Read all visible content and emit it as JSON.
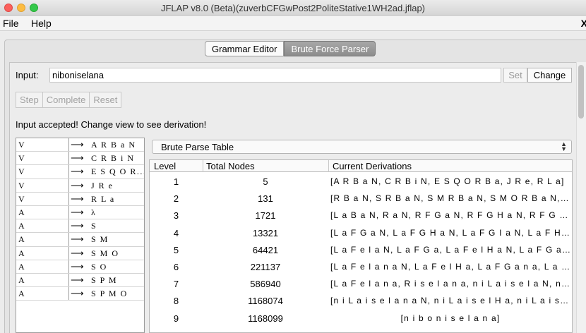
{
  "window": {
    "title": "JFLAP v8.0 (Beta)(zuverbCFGwPost2PoliteStative1WH2ad.jflap)"
  },
  "menu": {
    "file": "File",
    "help": "Help",
    "close": "X"
  },
  "tabs": {
    "grammar_editor": "Grammar Editor",
    "brute_force_parser": "Brute Force Parser"
  },
  "input": {
    "label": "Input:",
    "value": "niboniselana",
    "set_label": "Set",
    "change_label": "Change"
  },
  "controls": {
    "step": "Step",
    "complete": "Complete",
    "reset": "Reset"
  },
  "status": "Input accepted! Change view to see derivation!",
  "grammar": {
    "arrow": "⟶",
    "rows": [
      {
        "lhs": "V",
        "rhs": "A R B a N"
      },
      {
        "lhs": "V",
        "rhs": "C R B i N"
      },
      {
        "lhs": "V",
        "rhs": "E S Q O R..."
      },
      {
        "lhs": "V",
        "rhs": "J R e"
      },
      {
        "lhs": "V",
        "rhs": "R L a"
      },
      {
        "lhs": "A",
        "rhs": "λ"
      },
      {
        "lhs": "A",
        "rhs": "S"
      },
      {
        "lhs": "A",
        "rhs": "S M"
      },
      {
        "lhs": "A",
        "rhs": "S M O"
      },
      {
        "lhs": "A",
        "rhs": "S O"
      },
      {
        "lhs": "A",
        "rhs": "S P M"
      },
      {
        "lhs": "A",
        "rhs": "S P M O"
      }
    ]
  },
  "view_selector": {
    "selected": "Brute Parse Table"
  },
  "table": {
    "headers": {
      "level": "Level",
      "nodes": "Total Nodes",
      "derivations": "Current Derivations"
    },
    "rows": [
      {
        "level": "1",
        "nodes": "5",
        "derivations": "[A R B a N, C R B i N, E S Q O R B a, J R e, R L a]"
      },
      {
        "level": "2",
        "nodes": "131",
        "derivations": "[R B a N, S R B a N, S M R B a N, S M O R B a N, S ..."
      },
      {
        "level": "3",
        "nodes": "1721",
        "derivations": "[L a B a N, R a N, R F G a N, R F G H a N, R F G I a..."
      },
      {
        "level": "4",
        "nodes": "13321",
        "derivations": "[L a F G a N, L a F G H a N, L a F G I a N, L a F H a ..."
      },
      {
        "level": "5",
        "nodes": "64421",
        "derivations": "[L a F e l a N, L a F G a, L a F e l H a N, L a F G a n..."
      },
      {
        "level": "6",
        "nodes": "221137",
        "derivations": "[L a F e l a n a N, L a F e l H a, L a F G a n a, L a F ..."
      },
      {
        "level": "7",
        "nodes": "586940",
        "derivations": "[L a F e l a n a, R i s e l a n a, n i L a i s e l a N, n i..."
      },
      {
        "level": "8",
        "nodes": "1168074",
        "derivations": "[n i L a i s e l a n a N, n i L a i s e l H a, n i L a i s ..."
      },
      {
        "level": "9",
        "nodes": "1168099",
        "derivations": "[n i b o n i s e l a n a]"
      }
    ]
  }
}
